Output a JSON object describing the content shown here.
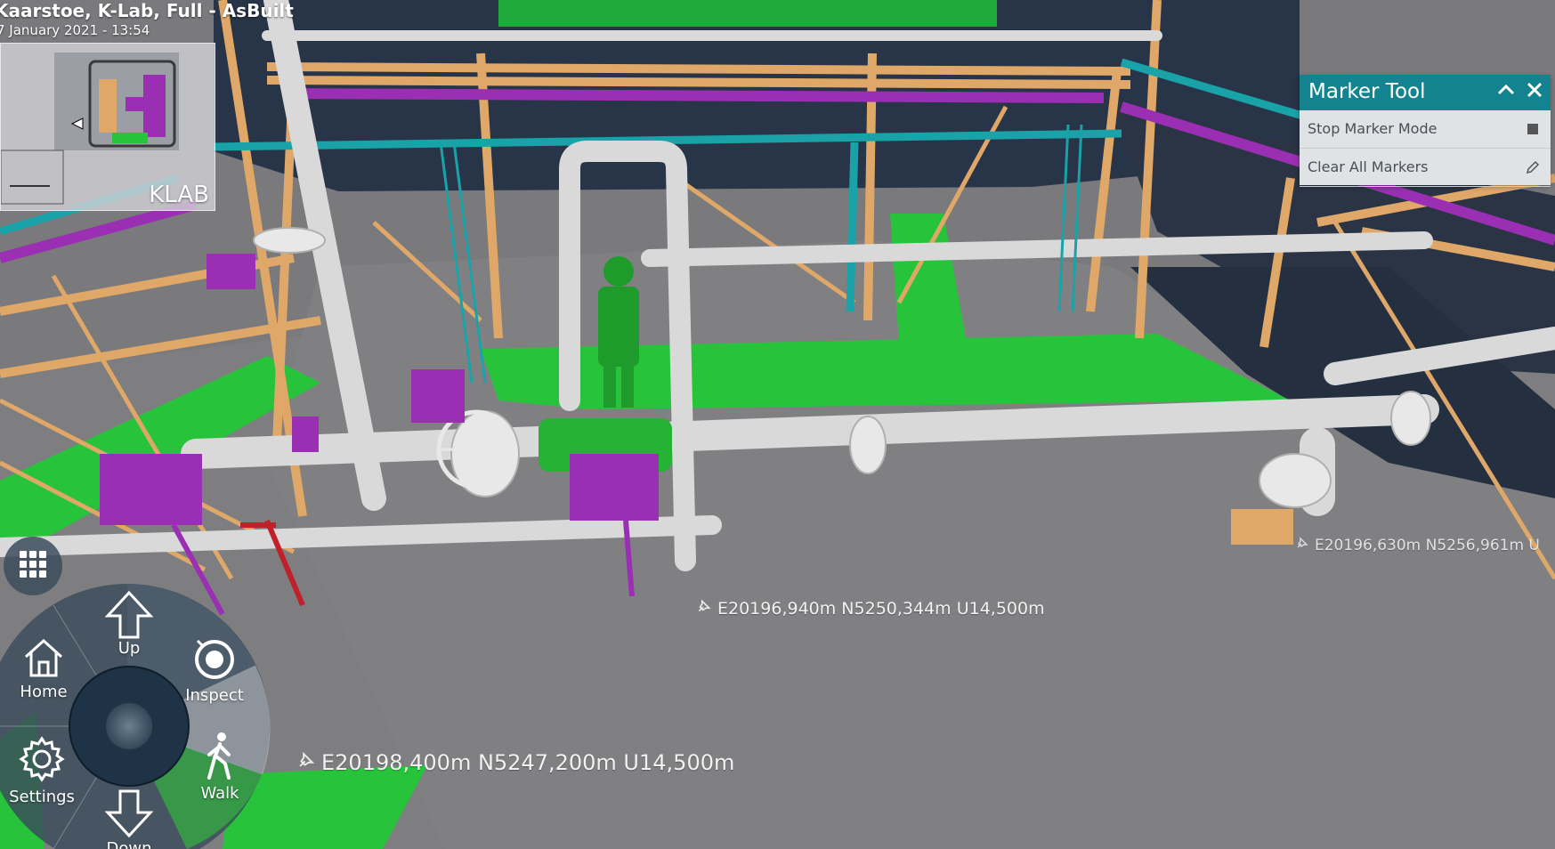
{
  "header": {
    "title": "Kaarstoe, K-Lab, Full - AsBuilt",
    "date": "7 January 2021 - 13:54"
  },
  "minimap": {
    "label": "KLAB"
  },
  "marker_tool": {
    "title": "Marker Tool",
    "collapse_icon": "chevron-up-icon",
    "close_icon": "close-icon",
    "items": [
      {
        "label": "Stop Marker Mode",
        "icon": "stop-icon"
      },
      {
        "label": "Clear All Markers",
        "icon": "pencil-icon"
      }
    ]
  },
  "markers": [
    {
      "text": "E20196,630m  N5256,961m  U"
    },
    {
      "text": "E20196,940m  N5250,344m  U14,500m"
    },
    {
      "text": "E20198,400m  N5247,200m  U14,500m"
    }
  ],
  "nav": {
    "up": "Up",
    "home": "Home",
    "inspect": "Inspect",
    "settings": "Settings",
    "walk": "Walk",
    "down": "Down"
  },
  "colors": {
    "accent": "#13838f",
    "pipe": "#d9d9d9",
    "structure_orange": "#e0a868",
    "cable_tray_purple": "#9b2fb3",
    "cable_tray_teal": "#19a3a8",
    "walkway_green": "#2fbf3a",
    "floor_grey": "#7e7e81",
    "fire_red": "#c0202a"
  }
}
